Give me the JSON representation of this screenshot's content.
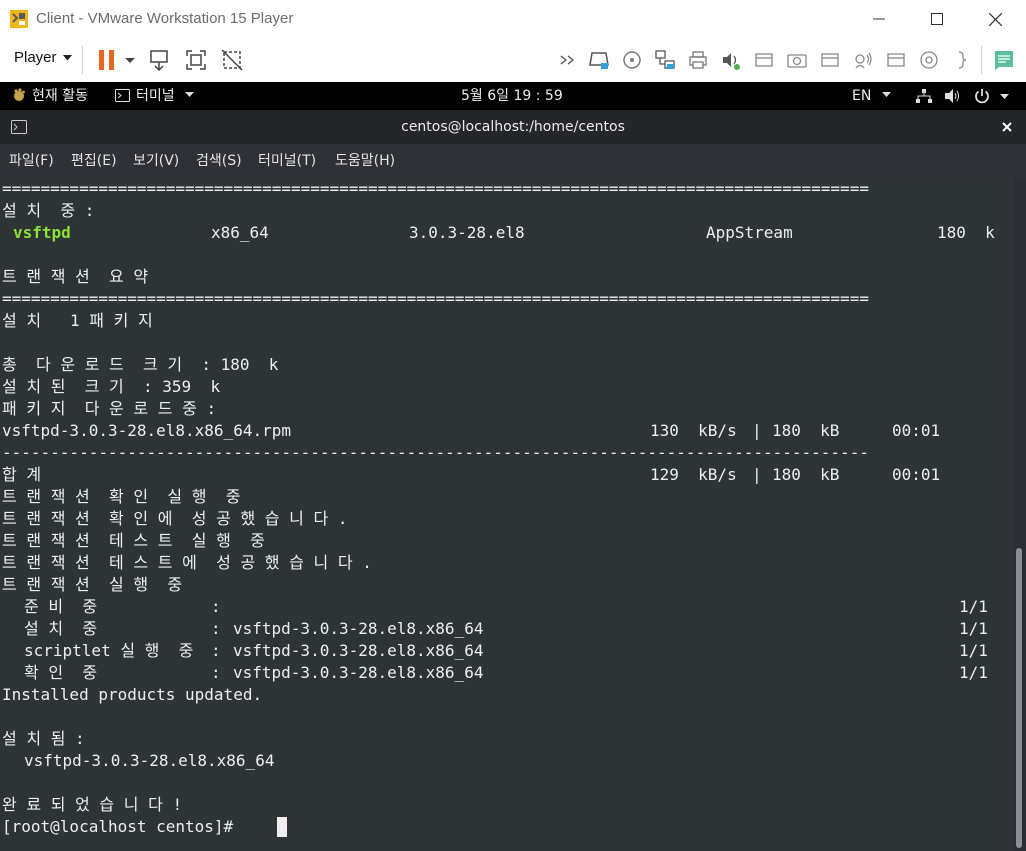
{
  "window": {
    "title": "Client - VMware Workstation 15 Player"
  },
  "toolbar": {
    "player_label": "Player",
    "icons": [
      "pause-icon",
      "send-ctrl-alt-del-icon",
      "fit-guest-icon",
      "unity-icon",
      "forward-icon",
      "hdd-icon",
      "cd-icon",
      "network-icon",
      "printer-icon",
      "sound-icon",
      "usb-icon",
      "camera-icon",
      "usb-icon",
      "bluetooth-icon",
      "usb-icon",
      "cd-icon",
      "bracket-icon",
      "message-icon"
    ]
  },
  "gnome": {
    "activities": "현재 활동",
    "app_menu": "터미널",
    "clock": "5월 6일  19 : 59",
    "lang": "EN"
  },
  "terminal": {
    "title": "centos@localhost:/home/centos",
    "menu": [
      "파일(F)",
      "편집(E)",
      "보기(V)",
      "검색(S)",
      "터미널(T)",
      "도움말(H)"
    ],
    "rule_double": "==========================================================================================",
    "rule_single": "------------------------------------------------------------------------------------------",
    "installing_header": "설 치  중 :",
    "pkg": {
      "name": "vsftpd",
      "arch": "x86_64",
      "version": "3.0.3-28.el8",
      "repo": "AppStream",
      "size": "180  k"
    },
    "summary_header": "트 랜 잭 션  요 약",
    "install_count": "설 치   1 패 키 지",
    "total_download": "총  다 운 로 드  크 기  : 180  k",
    "installed_size": "설 치 된  크 기  : 359  k",
    "downloading": "패 키 지  다 운 로 드 중 :",
    "rpm": {
      "file": "vsftpd-3.0.3-28.el8.x86_64.rpm",
      "speed": "130  kB/s",
      "bar": "|",
      "size": "180  kB",
      "time": "00:01"
    },
    "total": {
      "label": "합 계",
      "speed": "129  kB/s",
      "bar": "|",
      "size": "180  kB",
      "time": "00:01"
    },
    "tx_lines": [
      "트 랜 잭 션  확 인  실 행  중",
      "트 랜 잭 션  확 인 에  성 공 했 습 니 다 .",
      "트 랜 잭 션  테 스 트  실 행  중",
      "트 랜 잭 션  테 스 트 에  성 공 했 습 니 다 .",
      "트 랜 잭 션  실 행  중"
    ],
    "steps": [
      {
        "label": "준 비  중",
        "colon": ":",
        "pkg": "",
        "count": "1/1"
      },
      {
        "label": "설 치  중",
        "colon": ":",
        "pkg": "vsftpd-3.0.3-28.el8.x86_64",
        "count": "1/1"
      },
      {
        "label": "scriptlet 실 행  중",
        "colon": ":",
        "pkg": "vsftpd-3.0.3-28.el8.x86_64",
        "count": "1/1"
      },
      {
        "label": "확 인  중",
        "colon": ":",
        "pkg": "vsftpd-3.0.3-28.el8.x86_64",
        "count": "1/1"
      }
    ],
    "products_updated": "Installed products updated.",
    "installed_header": "설 치 됨 :",
    "installed_pkg": "vsftpd-3.0.3-28.el8.x86_64",
    "done": "완 료 되 었 습 니 다 !",
    "prompt": "[root@localhost centos]# "
  },
  "colors": {
    "terminal_bg": "#2e3436",
    "terminal_fg": "#eeeeee",
    "package_green": "#8ae234",
    "pause_orange": "#e8661d",
    "gnome_bar": "#000000"
  }
}
